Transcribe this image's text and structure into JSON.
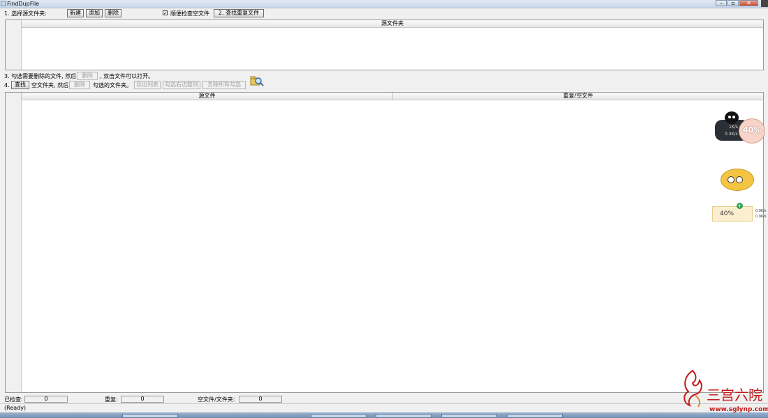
{
  "window": {
    "title": "FindDupFile"
  },
  "step1": {
    "label": "1. 选择源文件夹:",
    "new_button": "新建",
    "add_button": "添加",
    "delete_button": "删除",
    "check_empty_label": "顺便检查空文件",
    "find_button": "2. 查找重复文件"
  },
  "source_list": {
    "header": "源文件夹"
  },
  "step3": {
    "label_a": "3. 勾选需要删除的文件, 然后",
    "delete_button": "删除",
    "label_b": ", 双击文件可以打开。"
  },
  "step4": {
    "label_prefix": "4.",
    "find_button": "查找",
    "label_a": "空文件夹, 然后",
    "delete_button": "删除",
    "label_b": "勾选的文件夹。",
    "export_button": "导出列表",
    "select_right_button": "勾选右边整列",
    "clear_button": "去除所有勾选"
  },
  "results_list": {
    "col_source": "源文件",
    "col_duplicate": "重复/空文件"
  },
  "status": {
    "checked_label": "已检查:",
    "checked_value": "0",
    "duplicate_label": "重复:",
    "duplicate_value": "0",
    "empty_label": "空文件/文件夹:",
    "empty_value": "0",
    "ready_text": "(Ready)"
  },
  "overlay": {
    "net_speed_up": "1K/s",
    "net_speed_down": "0.3K/s",
    "percent_badge": "40%",
    "meter_percent": "40%",
    "meter_up": "0.9K/s",
    "meter_down": "0.9K/s",
    "watermark_cn": "三宫六院",
    "watermark_url": "www.sglynp.com"
  },
  "colors": {
    "accent": "#3a6ea5",
    "watermark": "#c41a1a"
  }
}
